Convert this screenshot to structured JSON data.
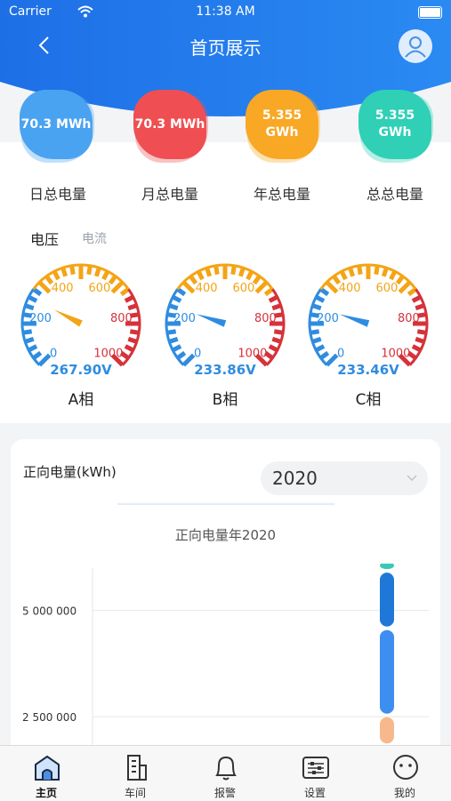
{
  "status_bar": {
    "carrier": "Carrier",
    "time": "11:38 AM"
  },
  "header": {
    "title": "首页展示"
  },
  "stats": [
    {
      "value": "70.3 MWh",
      "label": "日总电量",
      "color": "#4aa3f0"
    },
    {
      "value": "70.3 MWh",
      "label": "月总电量",
      "color": "#ef4f52"
    },
    {
      "value": "5.355\nGWh",
      "value_line1": "5.355",
      "value_line2": "GWh",
      "label": "年总电量",
      "color": "#f8a825"
    },
    {
      "value_line1": "5.355",
      "value_line2": "GWh",
      "label": "总总电量",
      "color": "#2fd0b6"
    }
  ],
  "tabs": {
    "active": "电压",
    "inactive": "电流"
  },
  "gauges": [
    {
      "value": 267.9,
      "text": "267.90V",
      "name": "A相",
      "needle_color": "#f4a416"
    },
    {
      "value": 233.86,
      "text": "233.86V",
      "name": "B相",
      "needle_color": "#2f8ce0"
    },
    {
      "value": 233.46,
      "text": "233.46V",
      "name": "C相",
      "needle_color": "#2f8ce0"
    }
  ],
  "gauge_ticks": [
    "0",
    "200",
    "400",
    "600",
    "800",
    "1000"
  ],
  "card": {
    "title": "正向电量(kWh)",
    "year": "2020",
    "chart_title": "正向电量年2020"
  },
  "chart_data": {
    "type": "bar",
    "y_ticks": [
      "5 000 000",
      "2 500 000"
    ],
    "y_tick_values": [
      5000000,
      2500000
    ],
    "ylim": [
      1500000,
      6100000
    ],
    "stacks": [
      {
        "category": "",
        "segments": [
          {
            "color": "#3ac9b2",
            "value": 250000
          },
          {
            "color": "#1f78d8",
            "value": 1350000
          },
          {
            "color": "#3d8ef0",
            "value": 2050000
          },
          {
            "color": "#f7b88c",
            "value": 700000
          }
        ]
      }
    ]
  },
  "tabbar": [
    {
      "label": "主页",
      "icon": "home-icon"
    },
    {
      "label": "车间",
      "icon": "building-icon"
    },
    {
      "label": "报警",
      "icon": "bell-icon"
    },
    {
      "label": "设置",
      "icon": "settings-icon"
    },
    {
      "label": "我的",
      "icon": "face-icon"
    }
  ],
  "colors": {
    "brand_blue": "#1f77e8",
    "gauge_blue": "#2f8ce0",
    "gauge_orange": "#f4a416",
    "gauge_red": "#d6323a"
  }
}
